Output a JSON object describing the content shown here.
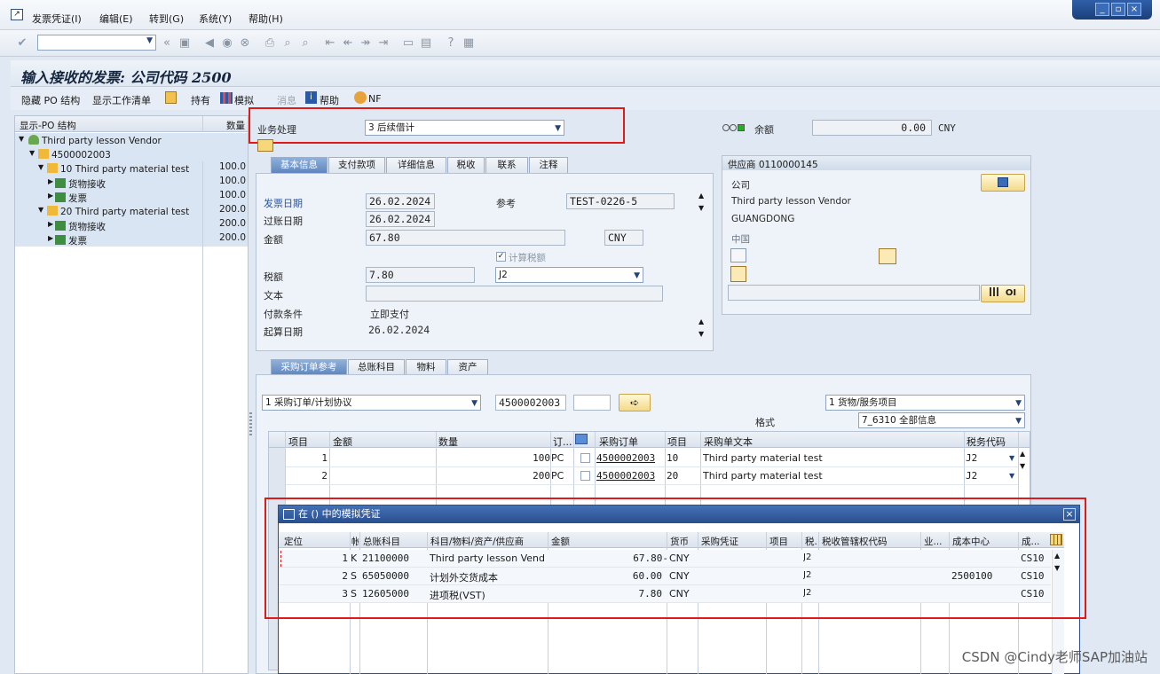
{
  "menu": [
    "发票凭证(I)",
    "编辑(E)",
    "转到(G)",
    "系统(Y)",
    "帮助(H)"
  ],
  "title": "输入接收的发票: 公司代码 2500",
  "appbar": {
    "hide_po": "隐藏 PO 结构",
    "worklist": "显示工作清单",
    "hold": "持有",
    "simulate": "模拟",
    "messages": "消息",
    "help": "帮助",
    "nf": "NF"
  },
  "tree": {
    "col_structure": "显示-PO 结构",
    "col_qty": "数量",
    "rows": [
      {
        "label": "Third party lesson Vendor",
        "qty": ""
      },
      {
        "label": "4500002003",
        "qty": ""
      },
      {
        "label": "10 Third party material test",
        "qty": "100.0"
      },
      {
        "label": "货物接收",
        "qty": "100.0"
      },
      {
        "label": "发票",
        "qty": "100.0"
      },
      {
        "label": "20 Third party material test",
        "qty": "200.0"
      },
      {
        "label": "货物接收",
        "qty": "200.0"
      },
      {
        "label": "发票",
        "qty": "200.0"
      }
    ]
  },
  "header": {
    "transaction_label": "业务处理",
    "transaction_value": "3 后续借计",
    "balance_label": "余额",
    "balance_value": "0.00",
    "balance_currency": "CNY"
  },
  "tabs_basic": [
    "基本信息",
    "支付款项",
    "详细信息",
    "税收",
    "联系",
    "注释"
  ],
  "basic": {
    "invoice_date_label": "发票日期",
    "invoice_date": "26.02.2024",
    "reference_label": "参考",
    "reference": "TEST-0226-5",
    "posting_date_label": "过账日期",
    "posting_date": "26.02.2024",
    "amount_label": "金额",
    "amount": "67.80",
    "currency": "CNY",
    "calc_tax_label": "计算税额",
    "tax_label": "税额",
    "tax": "7.80",
    "tax_code": "J2",
    "text_label": "文本",
    "payment_terms_label": "付款条件",
    "payment_terms": "立即支付",
    "baseline_label": "起算日期",
    "baseline": "26.02.2024"
  },
  "vendor": {
    "title": "供应商 0110000145",
    "company_label": "公司",
    "name": "Third party lesson Vendor",
    "city": "GUANGDONG",
    "country": "中国",
    "oi_label": "OI"
  },
  "tabs_po": [
    "采购订单参考",
    "总账科目",
    "物料",
    "资产"
  ],
  "po": {
    "ref_type": "1 采购订单/计划协议",
    "po_number": "4500002003",
    "item_type": "1 货物/服务项目",
    "layout_label": "格式",
    "layout": "7_6310 全部信息",
    "columns": [
      "项目",
      "金额",
      "数量",
      "订...",
      "采购订单",
      "项目",
      "采购单文本",
      "税务代码"
    ],
    "rows": [
      {
        "item": "1",
        "amount": "",
        "qty": "100",
        "unit": "PC",
        "po": "4500002003",
        "po_item": "10",
        "text": "Third party material test",
        "tax": "J2"
      },
      {
        "item": "2",
        "amount": "",
        "qty": "200",
        "unit": "PC",
        "po": "4500002003",
        "po_item": "20",
        "text": "Third party material test",
        "tax": "J2"
      }
    ]
  },
  "popup": {
    "title": "在 () 中的模拟凭证",
    "columns": [
      "定位",
      "帐",
      "总账科目",
      "科目/物料/资产/供应商",
      "金额",
      "货币",
      "采购凭证",
      "项目",
      "税.",
      "税收管辖权代码",
      "业...",
      "成本中心",
      "成..."
    ],
    "rows": [
      {
        "pos": "1",
        "type": "K",
        "gl": "21100000",
        "desc": "Third party lesson Vendor",
        "amount": "67.80-",
        "cur": "CNY",
        "tax": "J2",
        "cc": "",
        "co": "CS10"
      },
      {
        "pos": "2",
        "type": "S",
        "gl": "65050000",
        "desc": "计划外交货成本",
        "amount": "60.00",
        "cur": "CNY",
        "tax": "J2",
        "cc": "2500100",
        "co": "CS10"
      },
      {
        "pos": "3",
        "type": "S",
        "gl": "12605000",
        "desc": "进项税(VST)",
        "amount": "7.80",
        "cur": "CNY",
        "tax": "J2",
        "cc": "",
        "co": "CS10"
      }
    ]
  },
  "watermark": "CSDN @Cindy老师SAP加油站",
  "colors": {
    "highlight_red": "#e01919",
    "accent_blue": "#284f8e"
  }
}
